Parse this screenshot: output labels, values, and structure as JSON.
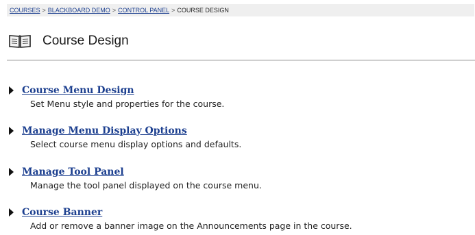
{
  "breadcrumb": {
    "items": [
      {
        "label": "COURSES",
        "link": true
      },
      {
        "label": "BLACKBOARD DEMO",
        "link": true
      },
      {
        "label": "CONTROL PANEL",
        "link": true
      },
      {
        "label": "COURSE DESIGN",
        "link": false
      }
    ],
    "separator": ">"
  },
  "header": {
    "icon": "book-icon",
    "title": "Course Design"
  },
  "items": [
    {
      "title": "Course Menu Design",
      "description": "Set Menu style and properties for the course."
    },
    {
      "title": "Manage Menu Display Options",
      "description": "Select course menu display options and defaults."
    },
    {
      "title": "Manage Tool Panel",
      "description": "Manage the tool panel displayed on the course menu."
    },
    {
      "title": "Course Banner",
      "description": "Add or remove a banner image on the Announcements page in the course."
    }
  ],
  "colors": {
    "link": "#1c3f8f",
    "breadcrumb_bg": "#efefef",
    "rule": "#cfcfcf"
  }
}
